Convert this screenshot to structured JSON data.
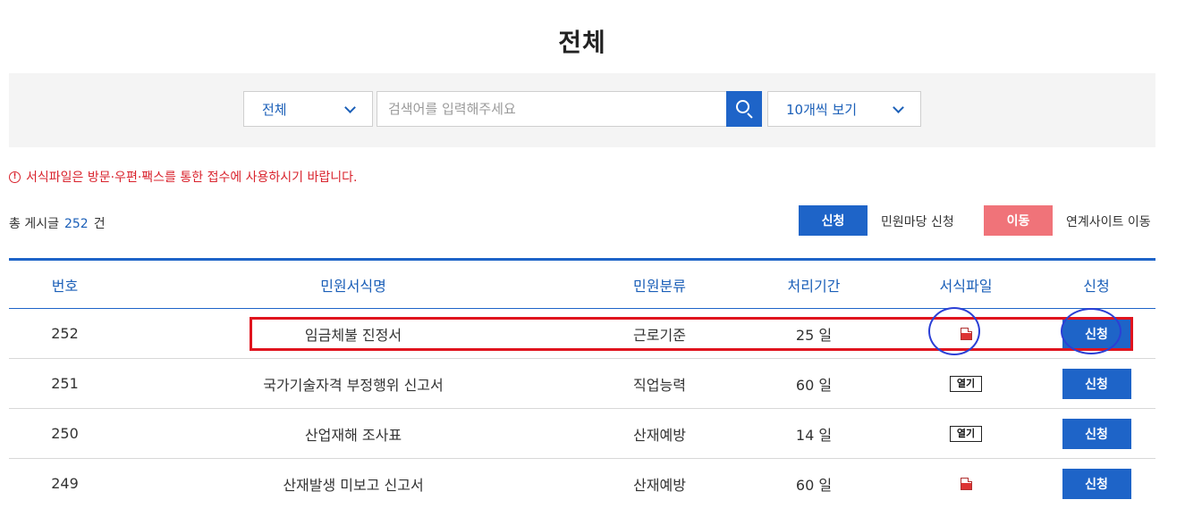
{
  "page": {
    "title": "전체"
  },
  "search": {
    "category_value": "전체",
    "placeholder": "검색어를 입력해주세요",
    "per_page_value": "10개씩 보기"
  },
  "notice": {
    "text": "서식파일은 방문·우편·팩스를 통한 접수에 사용하시기 바랍니다."
  },
  "summary": {
    "prefix": "총 게시글",
    "count": "252",
    "suffix": "건"
  },
  "actions": {
    "apply_button": "신청",
    "apply_label": "민원마당 신청",
    "move_button": "이동",
    "move_label": "연계사이트 이동"
  },
  "table": {
    "headers": [
      "번호",
      "민원서식명",
      "민원분류",
      "처리기간",
      "서식파일",
      "신청"
    ],
    "rows": [
      {
        "no": "252",
        "name": "임금체불 진정서",
        "category": "근로기준",
        "days": "25 일",
        "file": "pdf-icon",
        "apply": "신청"
      },
      {
        "no": "251",
        "name": "국가기술자격 부정행위 신고서",
        "category": "직업능력",
        "days": "60 일",
        "file": "열기",
        "apply": "신청"
      },
      {
        "no": "250",
        "name": "산업재해 조사표",
        "category": "산재예방",
        "days": "14 일",
        "file": "열기",
        "apply": "신청"
      },
      {
        "no": "249",
        "name": "산재발생 미보고 신고서",
        "category": "산재예방",
        "days": "60 일",
        "file": "pdf-icon",
        "apply": "신청"
      }
    ]
  },
  "colors": {
    "primary": "#1e64c8",
    "move": "#f07379",
    "notice": "#d9232d",
    "highlight_rect": "#e0141e",
    "highlight_circle": "#2b3fd6"
  },
  "icons": {
    "search": "search-icon",
    "dropdown": "chevron-down-icon",
    "file": "pdf-file-icon",
    "info": "info-circle-icon"
  }
}
